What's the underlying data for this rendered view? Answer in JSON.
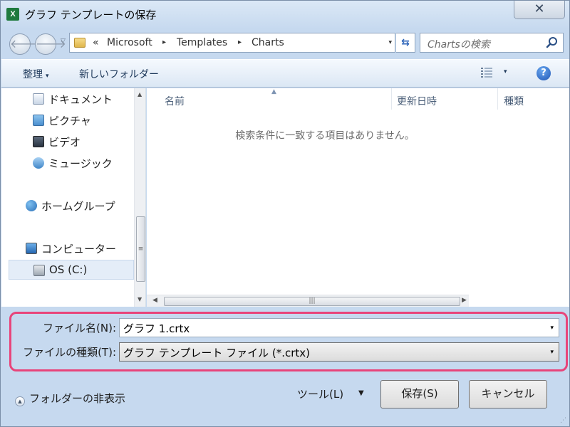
{
  "window": {
    "title": "グラフ テンプレートの保存",
    "app_icon": "X",
    "close_glyph": "✕"
  },
  "navigation": {
    "back_glyph": "🡐",
    "forward_glyph": "🡒",
    "dropdown_glyph": "▽"
  },
  "address": {
    "chevrons": "«",
    "breadcrumbs": [
      "Microsoft",
      "Templates",
      "Charts"
    ],
    "separator": "▸",
    "dropdown_glyph": "▾",
    "refresh_glyph": "⇆"
  },
  "search": {
    "placeholder": "Chartsの検索"
  },
  "toolbar": {
    "organize_label": "整理",
    "organize_caret": "▾",
    "new_folder_label": "新しいフォルダー",
    "view_caret": "▾",
    "help_glyph": "?"
  },
  "nav_pane": {
    "items": [
      {
        "label": "ドキュメント",
        "icon": "documents-icon"
      },
      {
        "label": "ピクチャ",
        "icon": "pictures-icon"
      },
      {
        "label": "ビデオ",
        "icon": "videos-icon"
      },
      {
        "label": "ミュージック",
        "icon": "music-icon"
      },
      {
        "label": "ホームグループ",
        "icon": "homegroup-icon"
      },
      {
        "label": "コンピューター",
        "icon": "computer-icon"
      },
      {
        "label": "OS (C:)",
        "icon": "drive-icon"
      }
    ],
    "scroll_up": "▲",
    "scroll_down": "▼",
    "thumb_grip": "≡"
  },
  "file_list": {
    "columns": [
      "名前",
      "更新日時",
      "種類"
    ],
    "sort_glyph": "▲",
    "empty_message": "検索条件に一致する項目はありません。",
    "scroll_left": "◀",
    "scroll_right": "▶",
    "thumb_grip": "|||"
  },
  "form": {
    "filename_label": "ファイル名(N):",
    "filename_value": "グラフ 1.crtx",
    "filetype_label": "ファイルの種類(T):",
    "filetype_value": "グラフ テンプレート ファイル (*.crtx)",
    "dropdown_glyph": "▾"
  },
  "footer": {
    "hide_folders_label": "フォルダーの非表示",
    "toggle_glyph": "▲",
    "tools_label": "ツール(L)",
    "tools_caret": "▼",
    "save_label": "保存(S)",
    "cancel_label": "キャンセル",
    "grip": "⋰"
  },
  "colors": {
    "accent_highlight": "#e8447a",
    "toolbar_text": "#1e395b",
    "help_blue": "#1f56b5"
  }
}
